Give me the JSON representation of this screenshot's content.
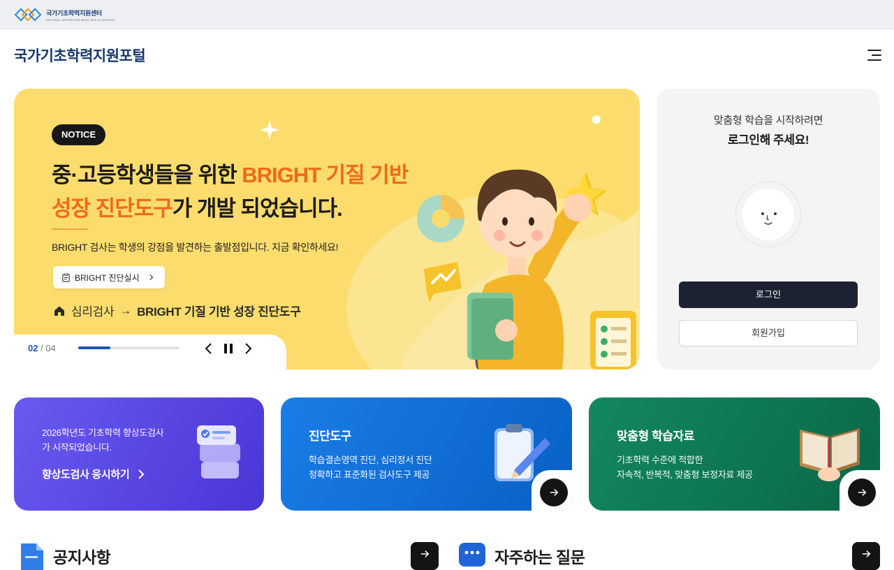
{
  "topbar": {
    "logo_name": "국가기초학력지원센터",
    "logo_sub": "NATIONAL CENTER FOR BASIC SKILLS SUPPORT"
  },
  "header": {
    "title": "국가기초학력지원포털",
    "menu_icon": "hamburger-menu-icon"
  },
  "banner": {
    "badge": "NOTICE",
    "headline_a": "중·고등학생들을 위한 ",
    "headline_b": "BRIGHT 기질 기반",
    "headline_c": "성장 진단도구",
    "headline_d": "가 개발 되었습니다.",
    "description": "BRIGHT 검사는 학생의 강점을 발견하는 출발점입니다. 지금 확인하세요!",
    "cta_label": "BRIGHT 진단실시",
    "breadcrumb_a": "심리검사",
    "breadcrumb_sep": "→",
    "breadcrumb_b": "BRIGHT 기질 기반 성장 진단도구",
    "slide_current": "02",
    "slide_total": "/ 04",
    "progress": 0.32,
    "colors": {
      "bg": "#fcdc6c",
      "highlight": "#f06a1a"
    }
  },
  "login": {
    "msg1": "맞춤형 학습을 시작하려면",
    "msg2": "로그인해 주세요!",
    "login_label": "로그인",
    "join_label": "회원가입"
  },
  "cards": {
    "card1": {
      "text_1": "2026학년도 기초학력 향상도검사",
      "text_2": "가 시작되었습니다.",
      "link": "향상도검사 응시하기"
    },
    "card2": {
      "title": "진단도구",
      "desc_1": "학습결손영역 진단, 심리정서 진단",
      "desc_2": "정확하고 표준화된 검사도구 제공"
    },
    "card3": {
      "title": "맞춤형 학습자료",
      "desc_1": "기초학력 수준에 적합한",
      "desc_2": "자속적, 반복적, 맞춤형 보정자료 제공"
    }
  },
  "sections": {
    "notice_title": "공지사항",
    "faq_title": "자주하는 질문"
  }
}
